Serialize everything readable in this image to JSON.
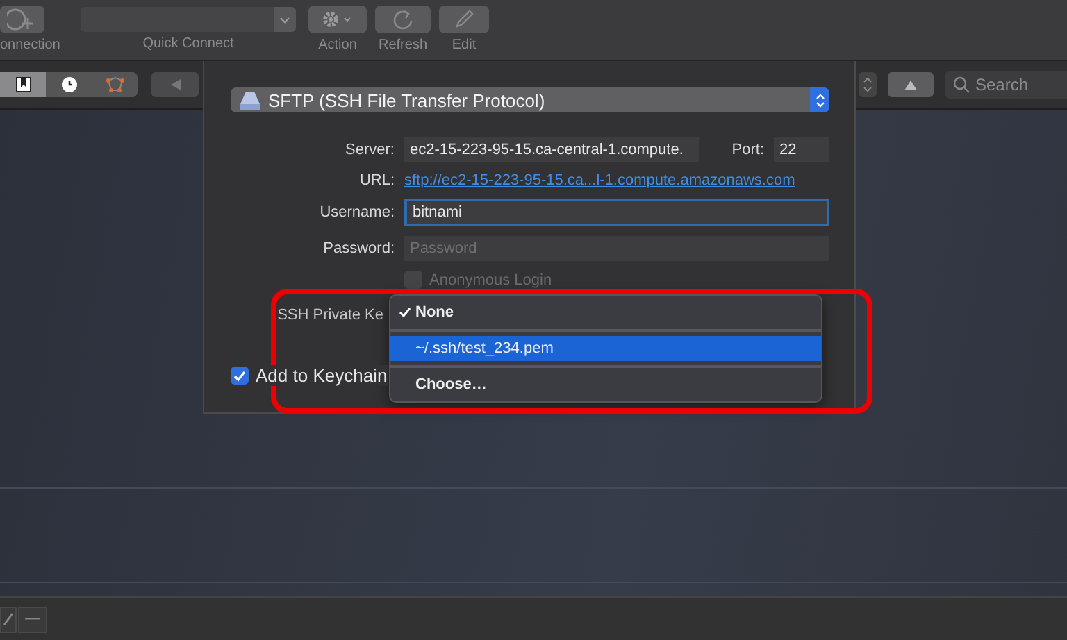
{
  "toolbar": {
    "items": [
      {
        "kind": "connection",
        "label": "onnection"
      },
      {
        "kind": "combo",
        "label": "Quick Connect"
      },
      {
        "kind": "action",
        "label": "Action"
      },
      {
        "kind": "refresh",
        "label": "Refresh"
      },
      {
        "kind": "edit",
        "label": "Edit"
      }
    ]
  },
  "view_tabs": [
    {
      "kind": "bookmarks",
      "selected": true
    },
    {
      "kind": "history",
      "selected": false
    },
    {
      "kind": "bonjour",
      "selected": false
    }
  ],
  "search": {
    "placeholder": "Search"
  },
  "dialog": {
    "protocol": "SFTP (SSH File Transfer Protocol)",
    "server": {
      "label": "Server:",
      "value": "ec2-15-223-95-15.ca-central-1.compute."
    },
    "port": {
      "label": "Port:",
      "value": "22"
    },
    "url": {
      "label": "URL:",
      "link": "sftp://ec2-15-223-95-15.ca...l-1.compute.amazonaws.com"
    },
    "username": {
      "label": "Username:",
      "value": "bitnami"
    },
    "password": {
      "label": "Password:",
      "placeholder": "Password"
    },
    "anonymous": {
      "label": "Anonymous Login",
      "checked": false,
      "disabled": true
    },
    "private_key": {
      "label": "SSH Private Ke"
    },
    "keychain": {
      "label": "Add to Keychain",
      "checked": true
    }
  },
  "key_menu": {
    "items": [
      {
        "label": "None",
        "checked": true,
        "selected": false
      },
      {
        "label": "~/.ssh/test_234.pem",
        "checked": false,
        "selected": true
      },
      {
        "label": "Choose…",
        "checked": false,
        "selected": false
      }
    ]
  }
}
